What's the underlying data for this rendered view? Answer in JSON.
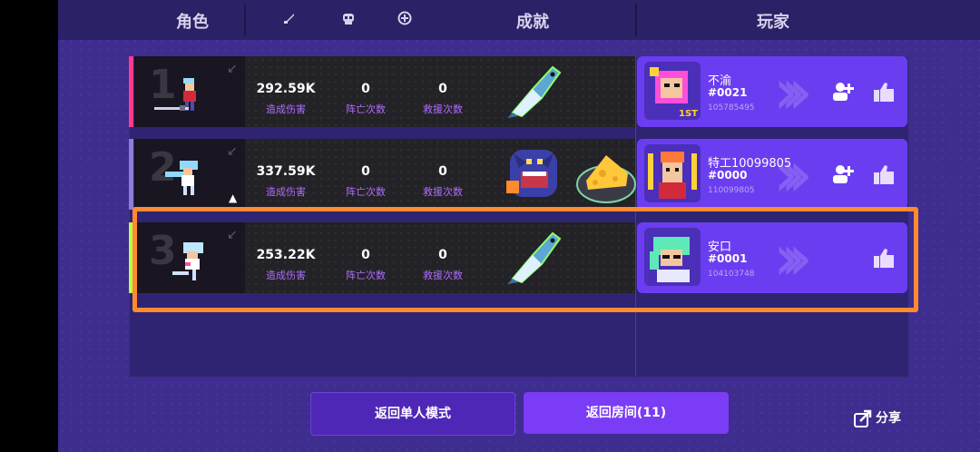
{
  "header": {
    "col_role": "角色",
    "col_achievement": "成就",
    "col_player": "玩家",
    "icons": [
      "sword-icon",
      "skull-icon",
      "plus-circle-icon"
    ]
  },
  "rows": [
    {
      "rank": "1",
      "accent": "#ff3b8a",
      "damage": "292.59K",
      "damage_label": "造成伤害",
      "deaths": "0",
      "deaths_label": "阵亡次数",
      "rescues": "0",
      "rescues_label": "救援次数",
      "achievements": [
        "fish"
      ],
      "player_name": "不渝",
      "player_tag": "#0021",
      "player_id": "105785495",
      "avatar_badge": "1ST",
      "can_add_friend": true
    },
    {
      "rank": "2",
      "accent": "#8f7dd8",
      "damage": "337.59K",
      "damage_label": "造成伤害",
      "deaths": "0",
      "deaths_label": "阵亡次数",
      "rescues": "0",
      "rescues_label": "救援次数",
      "achievements": [
        "wolf",
        "cheese"
      ],
      "player_name": "特工10099805",
      "player_tag": "#0000",
      "player_id": "110099805",
      "can_add_friend": true
    },
    {
      "rank": "3",
      "accent": "#b6ff4a",
      "damage": "253.22K",
      "damage_label": "造成伤害",
      "deaths": "0",
      "deaths_label": "阵亡次数",
      "rescues": "0",
      "rescues_label": "救援次数",
      "achievements": [
        "fish"
      ],
      "player_name": "安口",
      "player_tag": "#0001",
      "player_id": "104103748",
      "can_add_friend": false
    }
  ],
  "buttons": {
    "single_mode": "返回单人模式",
    "back_room": "返回房间(11)",
    "share": "分享"
  },
  "colors": {
    "panel": "#3f2c8f",
    "player_card": "#6b3df0",
    "highlight": "#ff8a30"
  }
}
